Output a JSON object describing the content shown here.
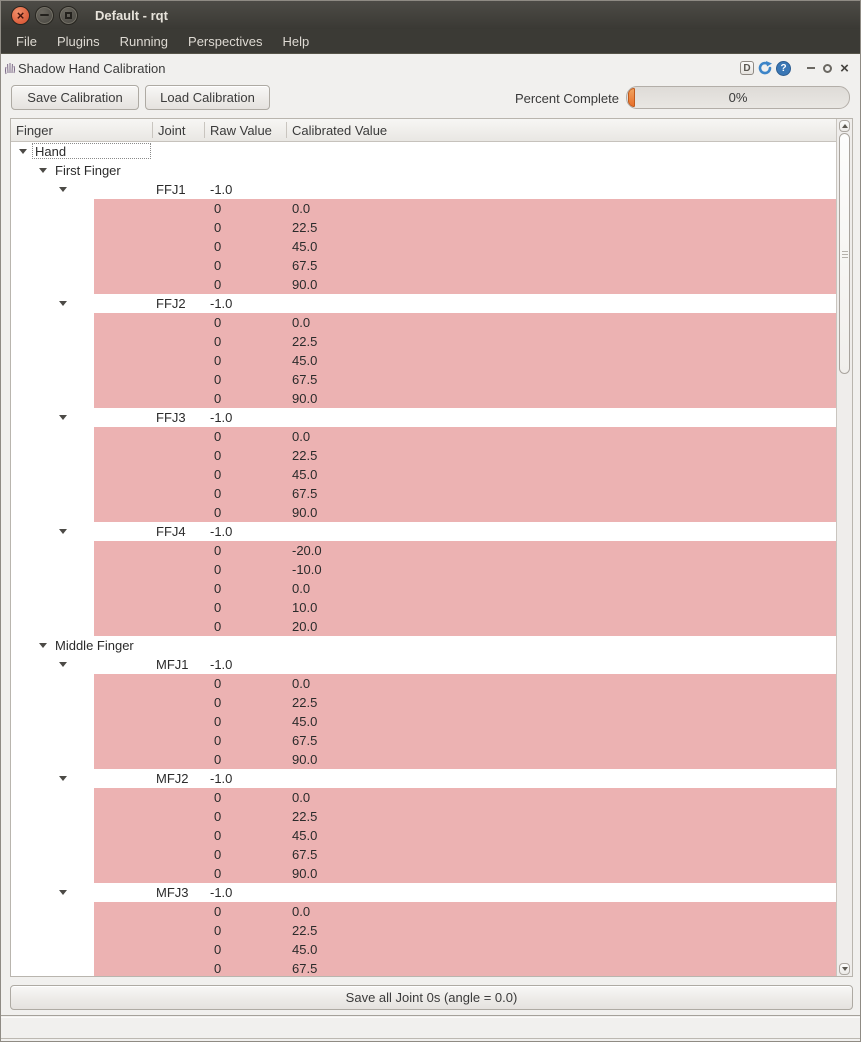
{
  "window": {
    "title": "Default - rqt",
    "menu": [
      "File",
      "Plugins",
      "Running",
      "Perspectives",
      "Help"
    ]
  },
  "plugin": {
    "title": "Shadow Hand Calibration",
    "dock_controls": {
      "dock_letter": "D",
      "help_glyph": "?"
    },
    "toolbar": {
      "save": "Save Calibration",
      "load": "Load Calibration",
      "percent_label": "Percent Complete",
      "progress_text": "0%",
      "progress_percent": 0
    },
    "table": {
      "columns": [
        "Finger",
        "Joint",
        "Raw Value",
        "Calibrated Value"
      ],
      "tree": {
        "label": "Hand",
        "children": [
          {
            "label": "First Finger",
            "joints": [
              {
                "name": "FFJ1",
                "raw": "-1.0",
                "points": [
                  [
                    "0",
                    "0.0"
                  ],
                  [
                    "0",
                    "22.5"
                  ],
                  [
                    "0",
                    "45.0"
                  ],
                  [
                    "0",
                    "67.5"
                  ],
                  [
                    "0",
                    "90.0"
                  ]
                ]
              },
              {
                "name": "FFJ2",
                "raw": "-1.0",
                "points": [
                  [
                    "0",
                    "0.0"
                  ],
                  [
                    "0",
                    "22.5"
                  ],
                  [
                    "0",
                    "45.0"
                  ],
                  [
                    "0",
                    "67.5"
                  ],
                  [
                    "0",
                    "90.0"
                  ]
                ]
              },
              {
                "name": "FFJ3",
                "raw": "-1.0",
                "points": [
                  [
                    "0",
                    "0.0"
                  ],
                  [
                    "0",
                    "22.5"
                  ],
                  [
                    "0",
                    "45.0"
                  ],
                  [
                    "0",
                    "67.5"
                  ],
                  [
                    "0",
                    "90.0"
                  ]
                ]
              },
              {
                "name": "FFJ4",
                "raw": "-1.0",
                "points": [
                  [
                    "0",
                    "-20.0"
                  ],
                  [
                    "0",
                    "-10.0"
                  ],
                  [
                    "0",
                    "0.0"
                  ],
                  [
                    "0",
                    "10.0"
                  ],
                  [
                    "0",
                    "20.0"
                  ]
                ]
              }
            ]
          },
          {
            "label": "Middle Finger",
            "joints": [
              {
                "name": "MFJ1",
                "raw": "-1.0",
                "points": [
                  [
                    "0",
                    "0.0"
                  ],
                  [
                    "0",
                    "22.5"
                  ],
                  [
                    "0",
                    "45.0"
                  ],
                  [
                    "0",
                    "67.5"
                  ],
                  [
                    "0",
                    "90.0"
                  ]
                ]
              },
              {
                "name": "MFJ2",
                "raw": "-1.0",
                "points": [
                  [
                    "0",
                    "0.0"
                  ],
                  [
                    "0",
                    "22.5"
                  ],
                  [
                    "0",
                    "45.0"
                  ],
                  [
                    "0",
                    "67.5"
                  ],
                  [
                    "0",
                    "90.0"
                  ]
                ]
              },
              {
                "name": "MFJ3",
                "raw": "-1.0",
                "points": [
                  [
                    "0",
                    "0.0"
                  ],
                  [
                    "0",
                    "22.5"
                  ],
                  [
                    "0",
                    "45.0"
                  ],
                  [
                    "0",
                    "67.5"
                  ]
                ]
              }
            ]
          }
        ]
      }
    },
    "save_all": "Save all Joint 0s (angle = 0.0)"
  },
  "colors": {
    "window_bg": "#f1f0ee",
    "titlebar_bg": "#3b3a35",
    "close_button": "#dd5f3d",
    "row_highlight": "#ecb2b2",
    "progress_accent": "#e8702a",
    "help_icon_bg": "#3a77b5",
    "reload_icon": "#3d85c8"
  }
}
